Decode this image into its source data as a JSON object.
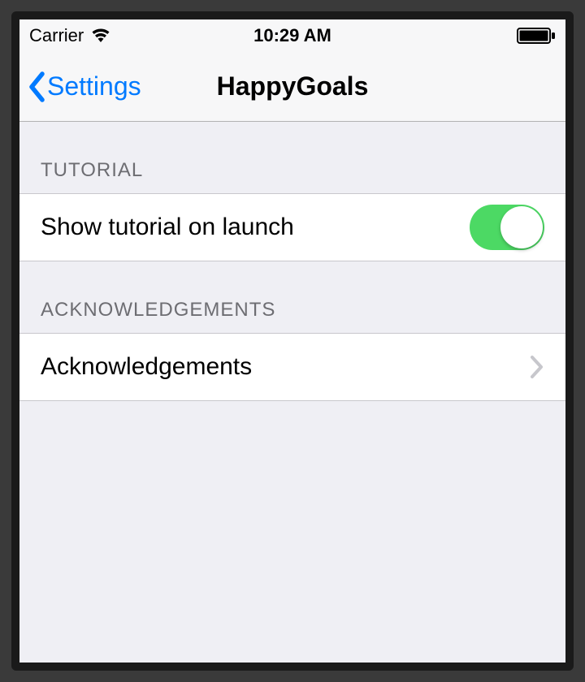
{
  "status": {
    "carrier": "Carrier",
    "time": "10:29 AM"
  },
  "nav": {
    "back_label": "Settings",
    "title": "HappyGoals"
  },
  "sections": {
    "tutorial": {
      "header": "TUTORIAL",
      "row": {
        "label": "Show tutorial on launch",
        "toggle_on": true
      }
    },
    "ack": {
      "header": "ACKNOWLEDGEMENTS",
      "row": {
        "label": "Acknowledgements"
      }
    }
  },
  "colors": {
    "tint": "#007aff",
    "switch_on": "#4cd964",
    "bg": "#efeff4"
  }
}
